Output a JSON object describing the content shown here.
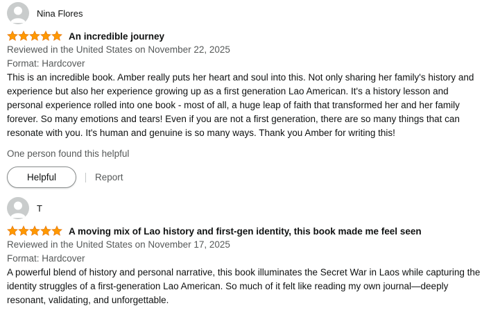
{
  "reviews": [
    {
      "profile_name": "Nina Flores",
      "rating": 5,
      "title": "An incredible journey",
      "date_line": "Reviewed in the United States on November 22, 2025",
      "format": "Format: Hardcover",
      "body": "This is an incredible book. Amber really puts her heart and soul into this. Not only sharing her family's history and experience but also her experience growing up as a first generation Lao American. It's a history lesson and personal experience rolled into one book - most of all, a huge leap of faith that transformed her and her family forever. So many emotions and tears! Even if you are not a first generation, there are so many things that can resonate with you. It's human and genuine is so many ways. Thank you Amber for writing this!",
      "helpful_count": "One person found this helpful",
      "helpful_label": "Helpful",
      "report_label": "Report"
    },
    {
      "profile_name": "T",
      "rating": 5,
      "title": "A moving mix of Lao history and first-gen identity, this book made me feel seen",
      "date_line": "Reviewed in the United States on November 17, 2025",
      "format": "Format: Hardcover",
      "body": "A powerful blend of history and personal narrative, this book illuminates the Secret War in Laos while capturing the identity struggles of a first-generation Lao American. So much of it felt like reading my own journal—deeply resonant, validating, and unforgettable."
    }
  ],
  "colors": {
    "star": "#ff9900",
    "star_outline": "#e47911",
    "secondary_text": "#565959",
    "avatar_bg": "#c9cccc"
  }
}
